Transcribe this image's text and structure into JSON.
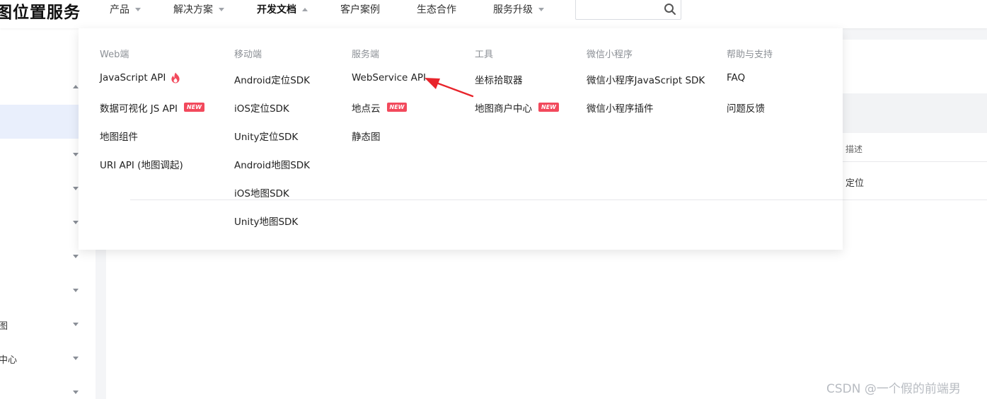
{
  "header": {
    "logo": "图位置服务",
    "nav": [
      {
        "label": "产品"
      },
      {
        "label": "解决方案"
      },
      {
        "label": "开发文档"
      },
      {
        "label": "客户案例"
      },
      {
        "label": "生态合作"
      },
      {
        "label": "服务升级"
      }
    ],
    "search": {
      "value": ""
    }
  },
  "dropdown": {
    "new_badge": "NEW",
    "columns": [
      {
        "heading": "Web端",
        "items": [
          {
            "label": "JavaScript API"
          },
          {
            "label": "数据可视化 JS API"
          },
          {
            "label": "地图组件"
          },
          {
            "label": "URI API (地图调起)"
          }
        ]
      },
      {
        "heading": "移动端",
        "items": [
          {
            "label": "Android定位SDK"
          },
          {
            "label": "iOS定位SDK"
          },
          {
            "label": "Unity定位SDK"
          },
          {
            "label": "Android地图SDK"
          },
          {
            "label": "iOS地图SDK"
          },
          {
            "label": "Unity地图SDK"
          }
        ]
      },
      {
        "heading": "服务端",
        "items": [
          {
            "label": "WebService API"
          },
          {
            "label": "地点云"
          },
          {
            "label": "静态图"
          }
        ]
      },
      {
        "heading": "工具",
        "items": [
          {
            "label": "坐标拾取器"
          },
          {
            "label": "地图商户中心"
          }
        ]
      },
      {
        "heading": "微信小程序",
        "items": [
          {
            "label": "微信小程序JavaScript SDK"
          },
          {
            "label": "微信小程序插件"
          }
        ]
      },
      {
        "heading": "帮助与支持",
        "items": [
          {
            "label": "FAQ"
          },
          {
            "label": "问题反馈"
          }
        ]
      }
    ]
  },
  "sidebar": {
    "items": [
      {
        "label": ""
      },
      {
        "label": ""
      },
      {
        "label": ""
      },
      {
        "label": ""
      },
      {
        "label": ""
      },
      {
        "label": ""
      },
      {
        "label": ""
      },
      {
        "label": "图"
      },
      {
        "label": "中心"
      },
      {
        "label": ""
      }
    ]
  },
  "content": {
    "table_header": "描述",
    "table_value": "定位"
  },
  "watermark": "CSDN @一个假的前端男",
  "colors": {
    "badge": "#f2495c",
    "arrow": "#e8242b",
    "selected_bg": "#e9effc"
  }
}
